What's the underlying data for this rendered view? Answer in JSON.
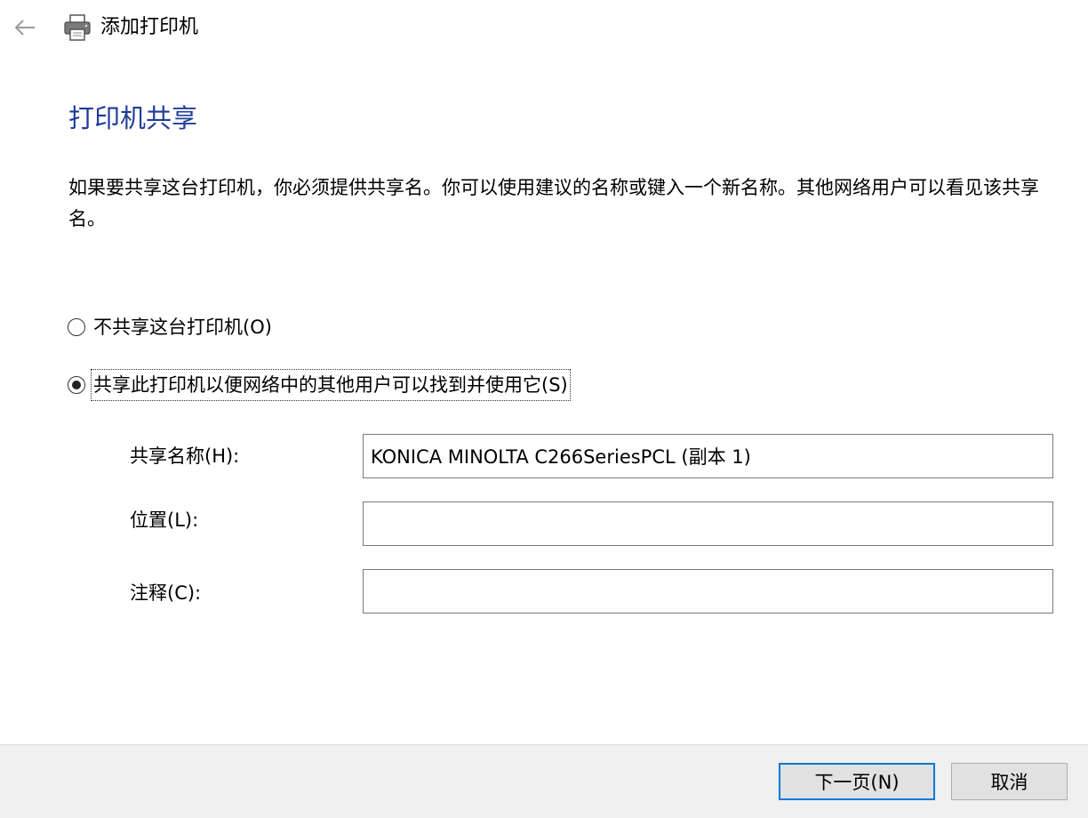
{
  "window": {
    "title": "添加打印机",
    "back_icon": "arrow-left-icon",
    "app_icon": "printer-icon"
  },
  "page": {
    "heading": "打印机共享",
    "description": "如果要共享这台打印机，你必须提供共享名。你可以使用建议的名称或键入一个新名称。其他网络用户可以看见该共享名。"
  },
  "sharing_options": [
    {
      "label": "不共享这台打印机(O)",
      "selected": false
    },
    {
      "label": "共享此打印机以便网络中的其他用户可以找到并使用它(S)",
      "selected": true
    }
  ],
  "fields": {
    "share_name": {
      "label": "共享名称(H):",
      "value": "KONICA MINOLTA C266SeriesPCL (副本 1)"
    },
    "location": {
      "label": "位置(L):",
      "value": ""
    },
    "comment": {
      "label": "注释(C):",
      "value": ""
    }
  },
  "footer": {
    "next_label": "下一页(N)",
    "cancel_label": "取消"
  },
  "colors": {
    "heading": "#1f3d99",
    "footer_bg": "#f0f0f0",
    "default_button_border": "#0078d7"
  }
}
